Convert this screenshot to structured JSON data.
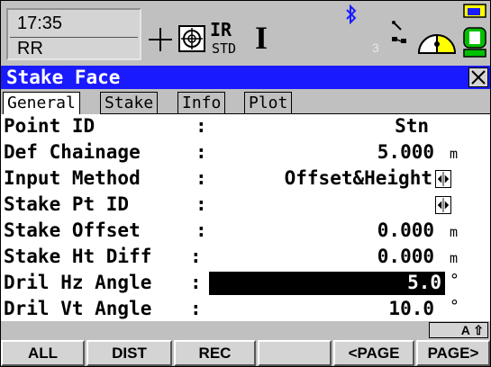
{
  "status": {
    "time": "17:35",
    "profile": "RR",
    "prism_label": "IR",
    "prism_sub": "STD",
    "ppm_mark": "I",
    "sat_count": "3",
    "icons": [
      "crosshair-icon",
      "prism-target-icon",
      "bluetooth-icon",
      "network-icon",
      "sun-clock-icon",
      "battery-icon"
    ]
  },
  "title": "Stake Face",
  "tabs": [
    "General",
    "Stake",
    "Info",
    "Plot"
  ],
  "fields": [
    {
      "label": "Point ID",
      "colon": ":",
      "value": "Stn",
      "unit": ""
    },
    {
      "label": "Def Chainage",
      "colon": ":",
      "value": "5.000",
      "unit": "m"
    },
    {
      "label": "Input Method",
      "colon": ":",
      "value": "Offset&Height",
      "unit": ""
    },
    {
      "label": "Stake Pt ID",
      "colon": ":",
      "value": "",
      "unit": ""
    },
    {
      "label": "Stake Offset",
      "colon": ":",
      "value": "0.000",
      "unit": "m"
    },
    {
      "label": "Stake Ht Diff",
      "colon": ":",
      "value": "0.000",
      "unit": "m"
    },
    {
      "label": "Dril Hz Angle",
      "colon": ":",
      "value": "5.0",
      "unit": "°"
    },
    {
      "label": "Dril Vt Angle",
      "colon": ":",
      "value": "10.0",
      "unit": "°"
    }
  ],
  "input_mode": "A ⇧",
  "softkeys": [
    "ALL",
    "DIST",
    "REC",
    "",
    "<PAGE",
    "PAGE>"
  ],
  "colors": {
    "title_bar": "#1a1aff",
    "highlight": "#000000",
    "panel": "#c0c0c0"
  }
}
